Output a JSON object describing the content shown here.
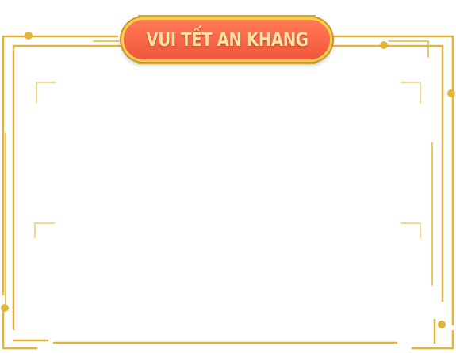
{
  "banner": {
    "title": "VUI TẾT AN KHANG"
  },
  "colors": {
    "frame_gold": "#e2b53a",
    "pill_fill": "#f2563b",
    "pill_border": "#f7cf45",
    "title_text": "#ffe3a6"
  },
  "icons": {
    "corner_ornament": "corner-bracket-icon",
    "dot_ornament": "gold-dot-icon"
  }
}
